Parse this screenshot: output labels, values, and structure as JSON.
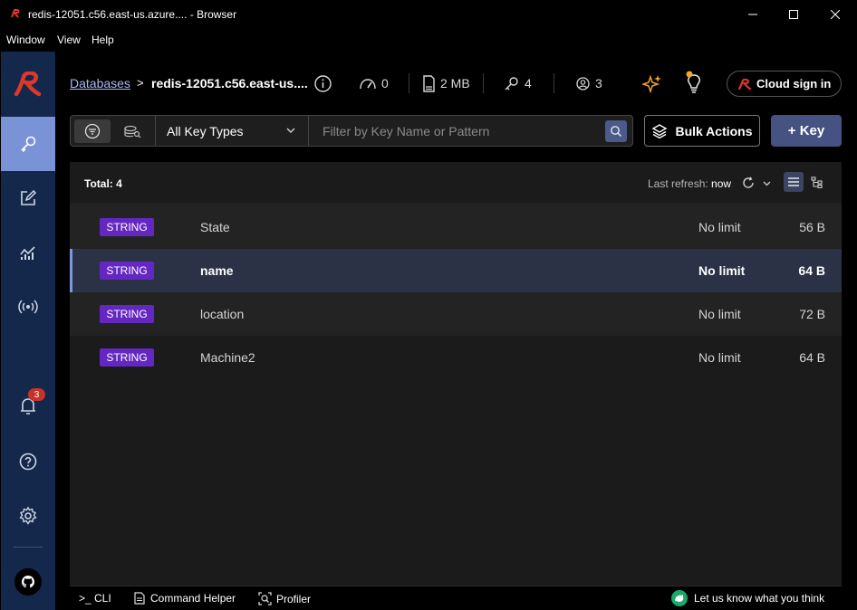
{
  "window": {
    "title": "redis-12051.c56.east-us.azure.... - Browser",
    "menu": [
      "Window",
      "View",
      "Help"
    ]
  },
  "sidebar": {
    "items": [
      {
        "name": "browser",
        "icon": "key-icon",
        "active": true
      },
      {
        "name": "workbench",
        "icon": "edit-icon",
        "active": false
      },
      {
        "name": "analysis",
        "icon": "analytics-icon",
        "active": false
      },
      {
        "name": "pubsub",
        "icon": "broadcast-icon",
        "active": false
      }
    ],
    "notifications_count": "3"
  },
  "header": {
    "breadcrumb_link": "Databases",
    "breadcrumb_sep": ">",
    "database_name": "redis-12051.c56.east-us....",
    "stats": {
      "ops": "0",
      "memory": "2 MB",
      "keys": "4",
      "clients": "3"
    },
    "cloud_sign_in": "Cloud sign in"
  },
  "toolbar": {
    "key_type_select": "All Key Types",
    "search_placeholder": "Filter by Key Name or Pattern",
    "bulk_actions": "Bulk Actions",
    "add_key": "+ Key"
  },
  "keylist": {
    "total": "Total: 4",
    "last_refresh_label": "Last refresh:",
    "last_refresh_value": "now",
    "rows": [
      {
        "type": "STRING",
        "name": "State",
        "ttl": "No limit",
        "size": "56 B"
      },
      {
        "type": "STRING",
        "name": "name",
        "ttl": "No limit",
        "size": "64 B"
      },
      {
        "type": "STRING",
        "name": "location",
        "ttl": "No limit",
        "size": "72 B"
      },
      {
        "type": "STRING",
        "name": "Machine2",
        "ttl": "No limit",
        "size": "64 B"
      }
    ]
  },
  "bottombar": {
    "cli": ">_ CLI",
    "command_helper": "Command Helper",
    "profiler": "Profiler",
    "feedback": "Let us know what you think"
  },
  "colors": {
    "sidebar_bg": "#13284a",
    "sidebar_active": "#7a92d6",
    "string_badge": "#6427c2",
    "brand_red": "#dc382c",
    "add_key_bg": "#465282"
  }
}
